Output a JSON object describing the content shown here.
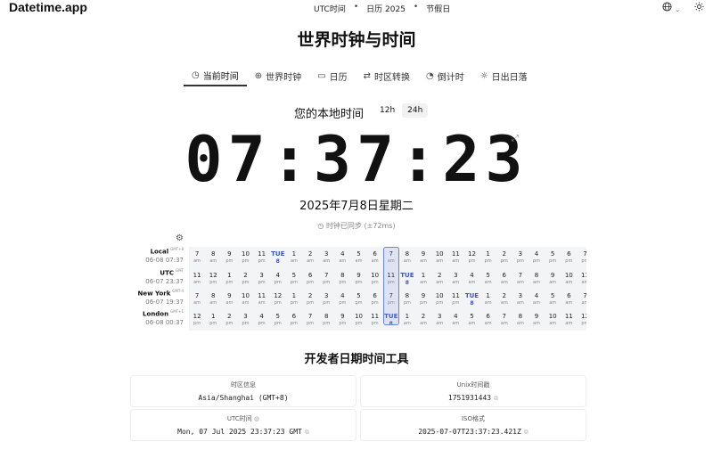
{
  "header": {
    "brand": "Datetime.app",
    "nav": [
      "UTC时间",
      "日历 2025",
      "节假日"
    ],
    "nav_separator": "•",
    "icons": [
      "globe-icon",
      "theme-toggle-icon"
    ]
  },
  "page_title": "世界时钟与时间",
  "tabs": [
    {
      "label": "当前时间",
      "icon": "clock-icon",
      "active": true
    },
    {
      "label": "世界时钟",
      "icon": "globe-icon",
      "active": false
    },
    {
      "label": "日历",
      "icon": "calendar-icon",
      "active": false
    },
    {
      "label": "时区转换",
      "icon": "swap-icon",
      "active": false
    },
    {
      "label": "倒计时",
      "icon": "timer-icon",
      "active": false
    },
    {
      "label": "日出日落",
      "icon": "sun-icon",
      "active": false
    }
  ],
  "local_time": {
    "heading": "您的本地时间",
    "format_12": "12h",
    "format_24": "24h",
    "format_selected": "24h",
    "time": "07:37:23",
    "date": "2025年7月8日星期二",
    "sync_status": "时钟已同步 (±72ms)"
  },
  "time_grid": {
    "rows": [
      {
        "name": "Local",
        "offset": "GMT+8",
        "datetime": "06-08 07:37",
        "hours": [
          [
            "7",
            "am"
          ],
          [
            "8",
            "am"
          ],
          [
            "9",
            "pm"
          ],
          [
            "10",
            "pm"
          ],
          [
            "11",
            "pm"
          ],
          [
            "TUE",
            "8"
          ],
          [
            "1",
            "am"
          ],
          [
            "2",
            "am"
          ],
          [
            "3",
            "am"
          ],
          [
            "4",
            "am"
          ],
          [
            "5",
            "am"
          ],
          [
            "6",
            "am"
          ],
          [
            "7",
            "am"
          ],
          [
            "8",
            "am"
          ],
          [
            "9",
            "am"
          ],
          [
            "10",
            "am"
          ],
          [
            "11",
            "am"
          ],
          [
            "12",
            "pm"
          ],
          [
            "1",
            "pm"
          ],
          [
            "2",
            "pm"
          ],
          [
            "3",
            "pm"
          ],
          [
            "4",
            "pm"
          ],
          [
            "5",
            "pm"
          ],
          [
            "6",
            "pm"
          ],
          [
            "7",
            "pm"
          ]
        ]
      },
      {
        "name": "UTC",
        "offset": "GMT",
        "datetime": "06-07 23:37",
        "hours": [
          [
            "11",
            "am"
          ],
          [
            "12",
            "pm"
          ],
          [
            "1",
            "pm"
          ],
          [
            "2",
            "pm"
          ],
          [
            "3",
            "pm"
          ],
          [
            "4",
            "pm"
          ],
          [
            "5",
            "pm"
          ],
          [
            "6",
            "pm"
          ],
          [
            "7",
            "pm"
          ],
          [
            "8",
            "pm"
          ],
          [
            "9",
            "pm"
          ],
          [
            "10",
            "pm"
          ],
          [
            "11",
            "pm"
          ],
          [
            "TUE",
            "8"
          ],
          [
            "1",
            "am"
          ],
          [
            "2",
            "am"
          ],
          [
            "3",
            "am"
          ],
          [
            "4",
            "am"
          ],
          [
            "5",
            "am"
          ],
          [
            "6",
            "am"
          ],
          [
            "7",
            "am"
          ],
          [
            "8",
            "am"
          ],
          [
            "9",
            "am"
          ],
          [
            "10",
            "am"
          ],
          [
            "11",
            "am"
          ]
        ]
      },
      {
        "name": "New York",
        "offset": "GMT-4",
        "datetime": "06-07 19:37",
        "hours": [
          [
            "7",
            "am"
          ],
          [
            "8",
            "am"
          ],
          [
            "9",
            "am"
          ],
          [
            "10",
            "am"
          ],
          [
            "11",
            "am"
          ],
          [
            "12",
            "pm"
          ],
          [
            "1",
            "pm"
          ],
          [
            "2",
            "pm"
          ],
          [
            "3",
            "pm"
          ],
          [
            "4",
            "pm"
          ],
          [
            "5",
            "pm"
          ],
          [
            "6",
            "pm"
          ],
          [
            "7",
            "pm"
          ],
          [
            "8",
            "pm"
          ],
          [
            "9",
            "pm"
          ],
          [
            "10",
            "pm"
          ],
          [
            "11",
            "pm"
          ],
          [
            "TUE",
            "8"
          ],
          [
            "1",
            "am"
          ],
          [
            "2",
            "am"
          ],
          [
            "3",
            "am"
          ],
          [
            "4",
            "am"
          ],
          [
            "5",
            "am"
          ],
          [
            "6",
            "am"
          ],
          [
            "7",
            "am"
          ]
        ]
      },
      {
        "name": "London",
        "offset": "GMT+1",
        "datetime": "06-08 00:37",
        "hours": [
          [
            "12",
            "pm"
          ],
          [
            "1",
            "pm"
          ],
          [
            "2",
            "pm"
          ],
          [
            "3",
            "pm"
          ],
          [
            "4",
            "pm"
          ],
          [
            "5",
            "pm"
          ],
          [
            "6",
            "pm"
          ],
          [
            "7",
            "pm"
          ],
          [
            "8",
            "pm"
          ],
          [
            "9",
            "pm"
          ],
          [
            "10",
            "pm"
          ],
          [
            "11",
            "pm"
          ],
          [
            "TUE",
            "8"
          ],
          [
            "1",
            "am"
          ],
          [
            "2",
            "am"
          ],
          [
            "3",
            "am"
          ],
          [
            "4",
            "am"
          ],
          [
            "5",
            "am"
          ],
          [
            "6",
            "am"
          ],
          [
            "7",
            "am"
          ],
          [
            "8",
            "am"
          ],
          [
            "9",
            "am"
          ],
          [
            "10",
            "am"
          ],
          [
            "11",
            "am"
          ],
          [
            "12",
            "pm"
          ]
        ]
      }
    ]
  },
  "dev_tools": {
    "title": "开发者日期时间工具",
    "cards": [
      {
        "label": "时区信息",
        "value": "Asia/Shanghai (GMT+8)"
      },
      {
        "label": "Unix时间戳",
        "value": "1751931443"
      },
      {
        "label": "UTC时间",
        "value": "Mon, 07 Jul 2025 23:37:23 GMT"
      },
      {
        "label": "ISO格式",
        "value": "2025-07-07T23:37:23.421Z"
      }
    ]
  }
}
